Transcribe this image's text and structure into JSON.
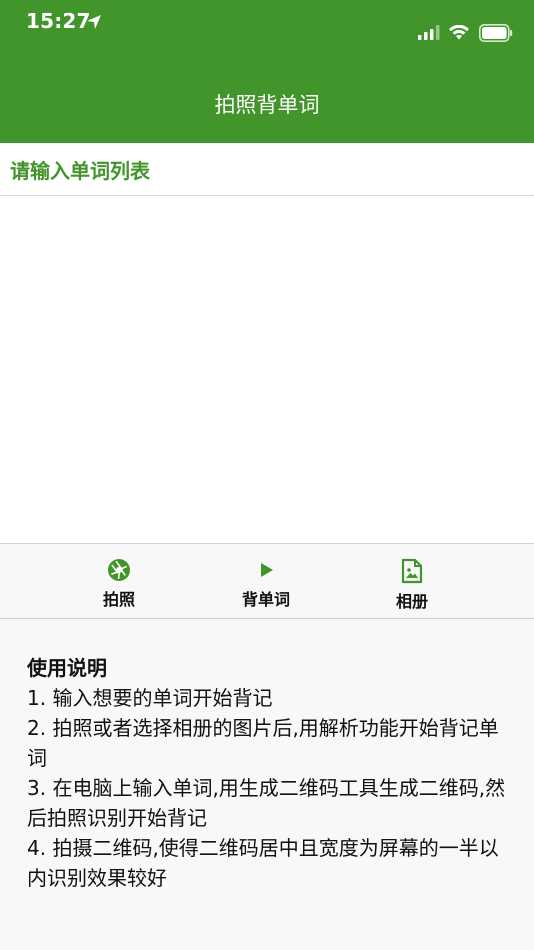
{
  "status_bar": {
    "time": "15:27",
    "icons": [
      "location-arrow-icon",
      "signal-bars-icon",
      "wifi-icon",
      "battery-icon"
    ]
  },
  "header": {
    "title": "拍照背单词",
    "background": "#42952b"
  },
  "input": {
    "label": "请输入单词列表",
    "value": ""
  },
  "toolbar": {
    "items": [
      {
        "label": "拍照",
        "icon": "camera-aperture-icon"
      },
      {
        "label": "背单词",
        "icon": "play-icon"
      },
      {
        "label": "相册",
        "icon": "photo-file-icon"
      }
    ],
    "accent": "#42952b"
  },
  "instructions": {
    "heading": "使用说明",
    "lines": [
      "1. 输入想要的单词开始背记",
      "2. 拍照或者选择相册的图片后,用解析功能开始背记单词",
      "3. 在电脑上输入单词,用生成二维码工具生成二维码,然后拍照识别开始背记",
      "4. 拍摄二维码,使得二维码居中且宽度为屏幕的一半以内识别效果较好"
    ]
  }
}
